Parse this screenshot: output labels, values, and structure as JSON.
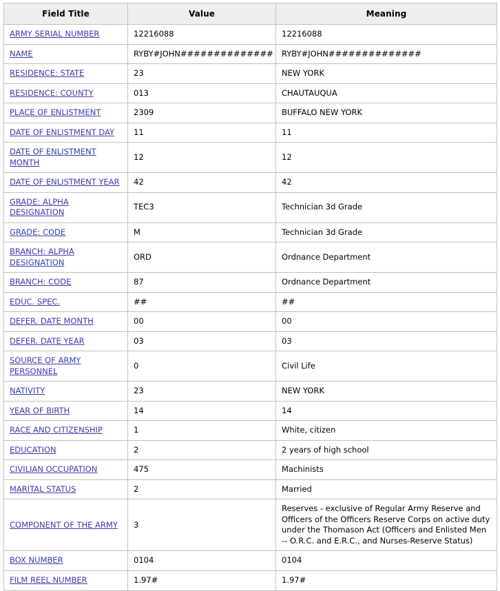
{
  "table": {
    "headers": {
      "field_title": "Field Title",
      "value": "Value",
      "meaning": "Meaning"
    },
    "rows": [
      {
        "field": "ARMY SERIAL NUMBER",
        "value": "12216088",
        "meaning": "12216088"
      },
      {
        "field": "NAME",
        "value": "RYBY#JOHN##############",
        "meaning": "RYBY#JOHN##############"
      },
      {
        "field": "RESIDENCE: STATE",
        "value": "23",
        "meaning": "NEW YORK"
      },
      {
        "field": "RESIDENCE: COUNTY",
        "value": "013",
        "meaning": "CHAUTAUQUA"
      },
      {
        "field": "PLACE OF ENLISTMENT",
        "value": "2309",
        "meaning": "BUFFALO NEW YORK"
      },
      {
        "field": "DATE OF ENLISTMENT DAY",
        "value": "11",
        "meaning": "11"
      },
      {
        "field": "DATE OF ENLISTMENT MONTH",
        "value": "12",
        "meaning": "12"
      },
      {
        "field": "DATE OF ENLISTMENT YEAR",
        "value": "42",
        "meaning": "42"
      },
      {
        "field": "GRADE: ALPHA DESIGNATION",
        "value": "TEC3",
        "meaning": "Technician 3d Grade"
      },
      {
        "field": "GRADE: CODE",
        "value": "M",
        "meaning": "Technician 3d Grade"
      },
      {
        "field": "BRANCH: ALPHA DESIGNATION",
        "value": "ORD",
        "meaning": "Ordnance Department"
      },
      {
        "field": "BRANCH: CODE",
        "value": "87",
        "meaning": "Ordnance Department"
      },
      {
        "field": "EDUC. SPEC.",
        "value": "##",
        "meaning": "##"
      },
      {
        "field": "DEFER. DATE MONTH",
        "value": "00",
        "meaning": "00"
      },
      {
        "field": "DEFER. DATE YEAR",
        "value": "03",
        "meaning": "03"
      },
      {
        "field": "SOURCE OF ARMY PERSONNEL",
        "value": "0",
        "meaning": "Civil Life"
      },
      {
        "field": "NATIVITY",
        "value": "23",
        "meaning": "NEW YORK"
      },
      {
        "field": "YEAR OF BIRTH",
        "value": "14",
        "meaning": "14"
      },
      {
        "field": "RACE AND CITIZENSHIP",
        "value": "1",
        "meaning": "White, citizen"
      },
      {
        "field": "EDUCATION",
        "value": "2",
        "meaning": "2 years of high school"
      },
      {
        "field": "CIVILIAN OCCUPATION",
        "value": "475",
        "meaning": "Machinists"
      },
      {
        "field": "MARITAL STATUS",
        "value": "2",
        "meaning": "Married"
      },
      {
        "field": "COMPONENT OF THE ARMY",
        "value": "3",
        "meaning": "Reserves - exclusive of Regular Army Reserve and Officers of the Officers Reserve Corps on active duty under the Thomason Act (Officers and Enlisted Men -- O.R.C. and E.R.C., and Nurses-Reserve Status)"
      },
      {
        "field": "BOX NUMBER",
        "value": "0104",
        "meaning": "0104"
      },
      {
        "field": "FILM REEL NUMBER",
        "value": "1.97#",
        "meaning": "1.97#"
      }
    ]
  },
  "colors": {
    "link": "#3b3bb0",
    "header_background": "#eeeeee",
    "border": "#c0c0c0"
  }
}
